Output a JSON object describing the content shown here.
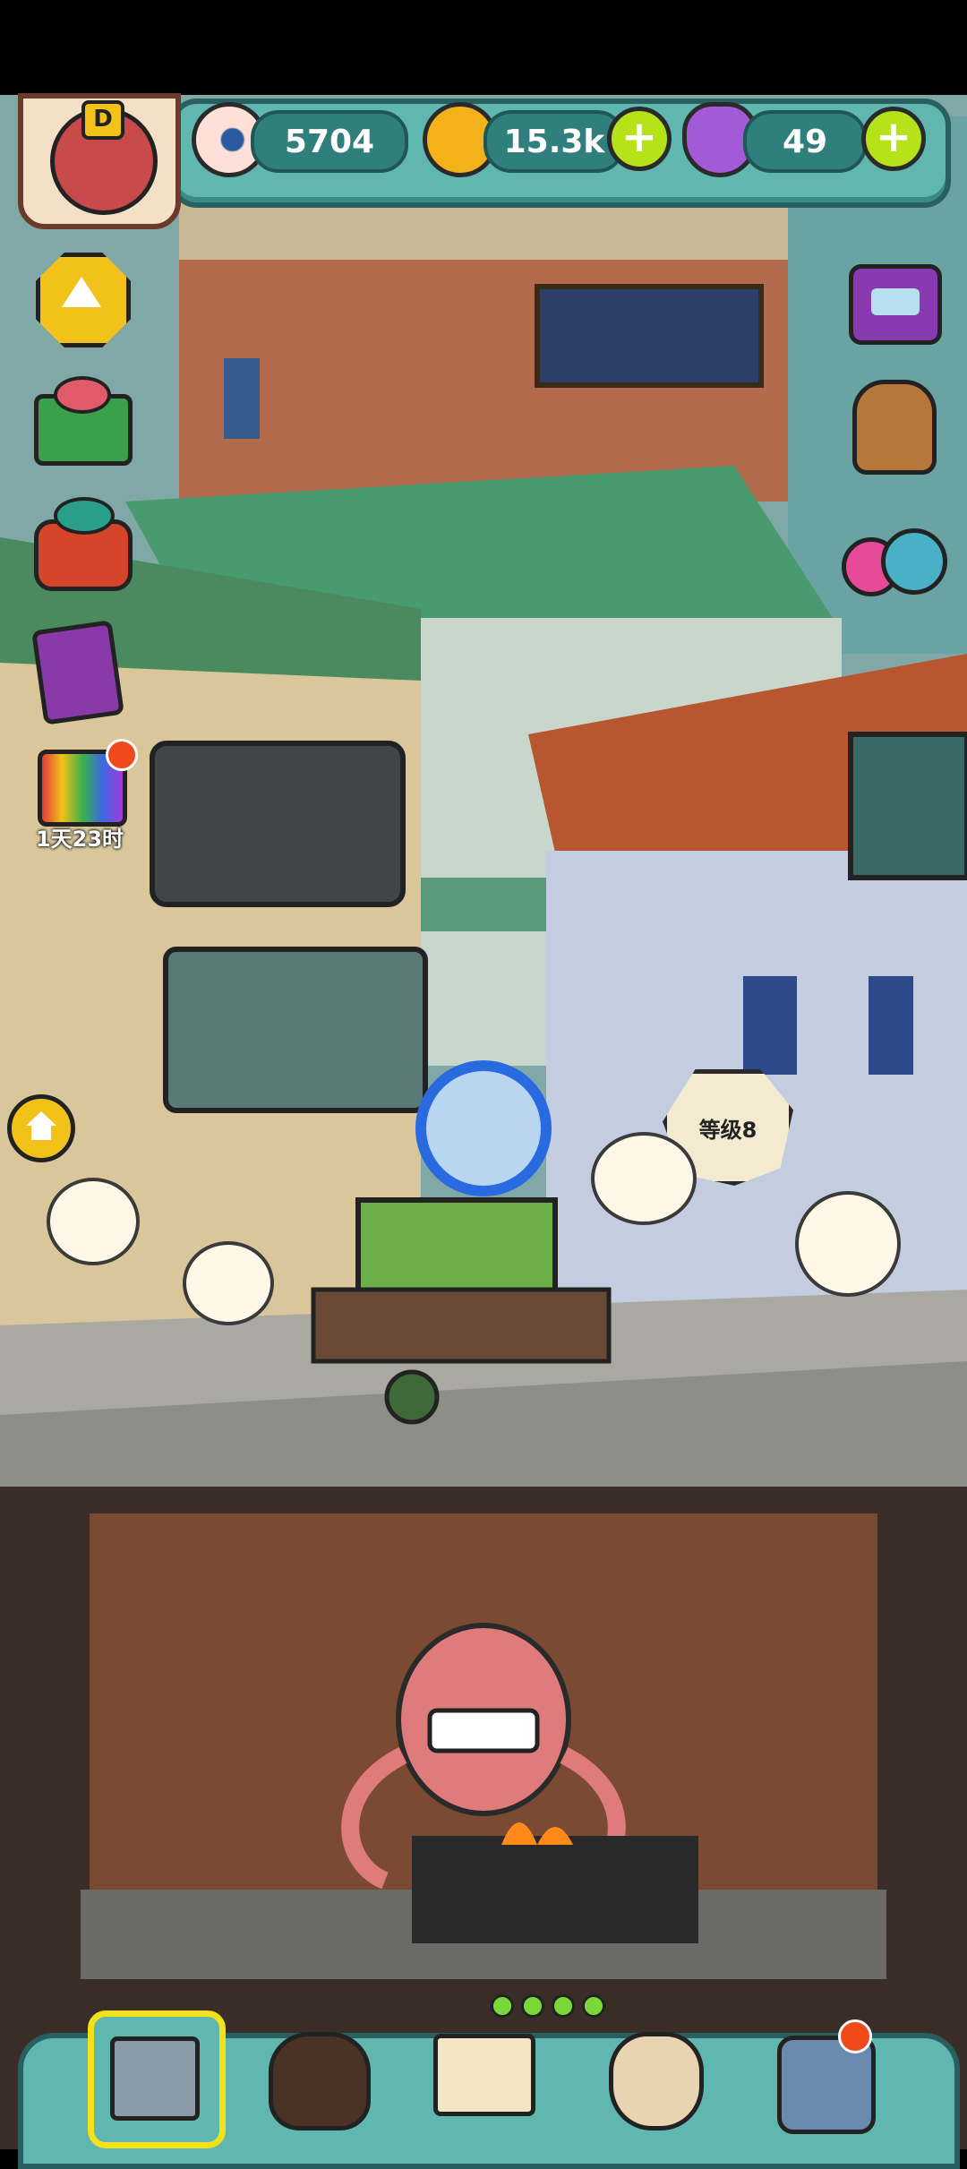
{
  "status_bar": {},
  "resources": {
    "eyes": "5704",
    "coins": "15.3k",
    "potions": "49"
  },
  "left_panel": {
    "event_timer": "1天23时"
  },
  "scene": {
    "level_bubble": "等级8"
  },
  "colors": {
    "teal_frame": "#5fb7b0",
    "plus_green": "#b6e21a"
  }
}
